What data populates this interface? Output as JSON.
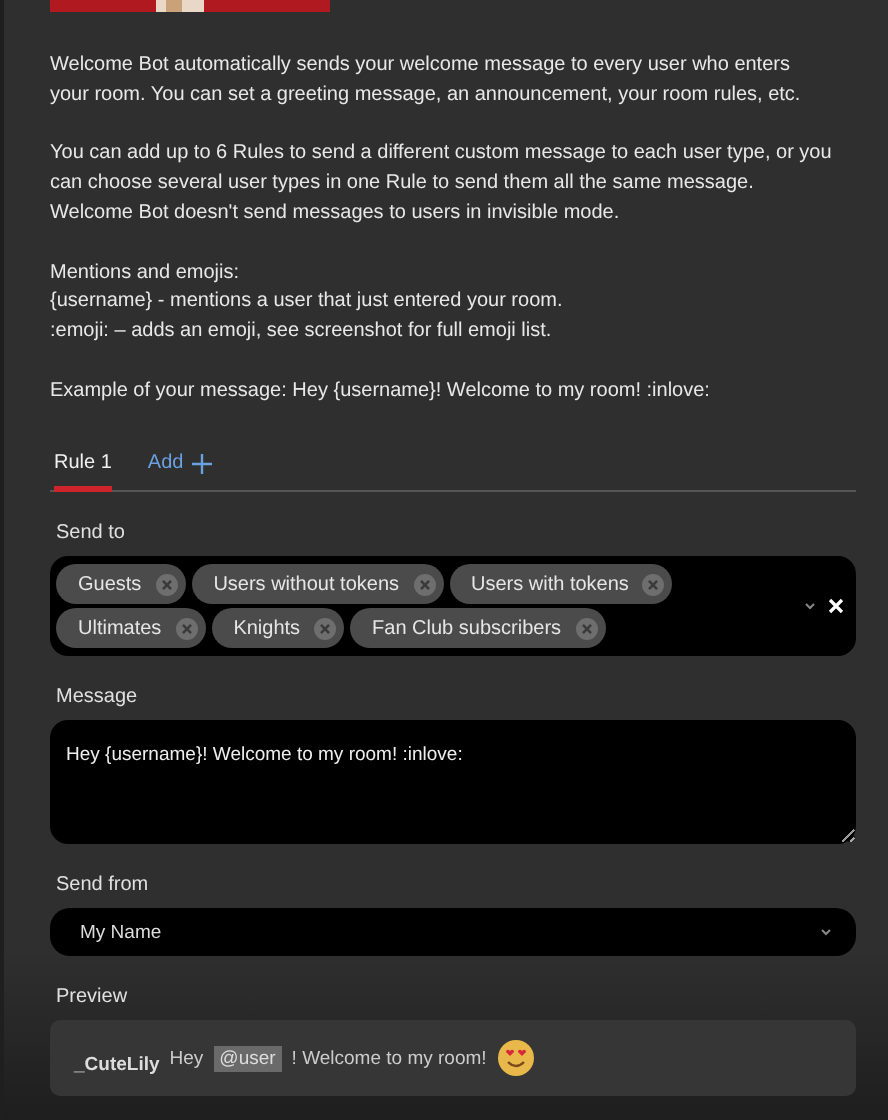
{
  "banner": {
    "kind": "picture"
  },
  "intro": [
    [
      "Welcome Bot automatically sends your welcome message to every user who enters",
      "your room. You can set a greeting message, an announcement, your room rules, etc."
    ],
    [
      "You can add up to 6 Rules to send a different custom message to each user type, or you",
      "can choose several user types in one Rule to send them all the same message.",
      "Welcome Bot doesn't send messages to users in invisible mode."
    ],
    [
      "Mentions and emojis:",
      "{username} - mentions a user that just entered your room.",
      ":emoji: – adds an emoji, see screenshot for full emoji list."
    ],
    [
      "Example of your message: Hey {username}! Welcome to my room! :inlove:"
    ]
  ],
  "tabs": [
    {
      "label": "Rule 1",
      "selected": true
    }
  ],
  "add_tab": {
    "label": "Add"
  },
  "send_to": {
    "label": "Send to",
    "chips": [
      "Guests",
      "Users without tokens",
      "Users with tokens",
      "Ultimates",
      "Knights",
      "Fan Club subscribers"
    ]
  },
  "message": {
    "label": "Message",
    "value": "Hey {username}! Welcome to my room! :inlove:"
  },
  "send_from": {
    "label": "Send from",
    "value": "My Name"
  },
  "preview": {
    "label": "Preview",
    "sender": "_CuteLily",
    "greeting": "Hey",
    "mention": "@user",
    "text": "! Welcome to my room!"
  }
}
